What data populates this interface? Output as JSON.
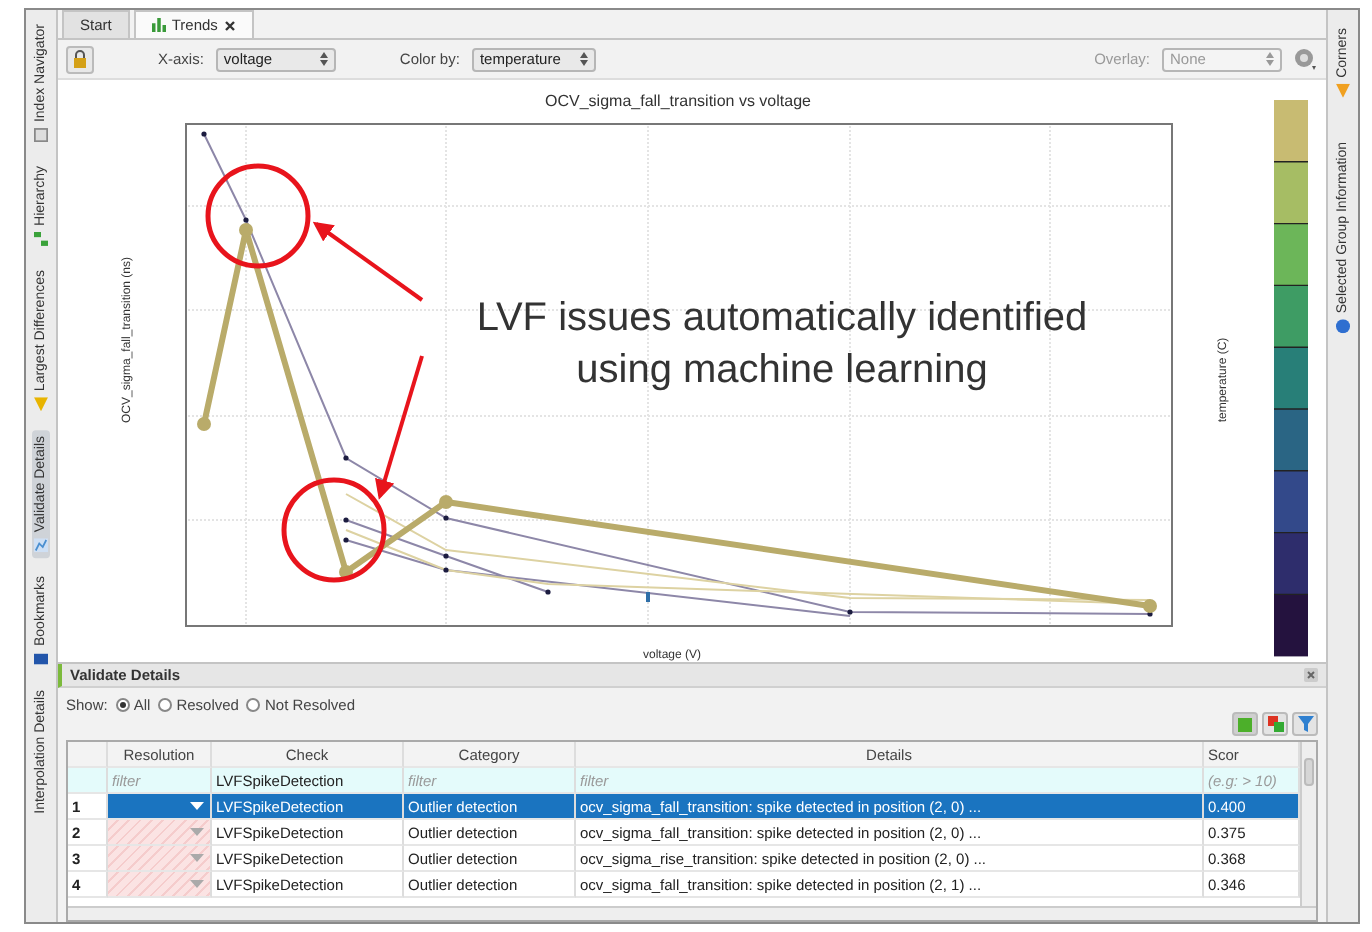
{
  "left_panel_tabs": [
    {
      "label": "Index Navigator",
      "selected": false
    },
    {
      "label": "Hierarchy",
      "selected": false
    },
    {
      "label": "Largest Differences",
      "selected": false
    },
    {
      "label": "Validate Details",
      "selected": true
    },
    {
      "label": "Bookmarks",
      "selected": false
    },
    {
      "label": "Interpolation Details",
      "selected": false
    }
  ],
  "right_panel_tabs": [
    {
      "label": "Corners"
    },
    {
      "label": "Selected Group Information"
    }
  ],
  "tabs": [
    {
      "label": "Start",
      "selected": false,
      "closable": false
    },
    {
      "label": "Trends",
      "selected": true,
      "closable": true
    }
  ],
  "toolbar": {
    "x_axis": {
      "label": "X-axis:",
      "value": "voltage"
    },
    "color_by": {
      "label": "Color by:",
      "value": "temperature"
    },
    "overlay": {
      "label": "Overlay:",
      "value": "None",
      "disabled": true
    }
  },
  "chart": {
    "title": "OCV_sigma_fall_transition vs voltage",
    "ylabel": "OCV_sigma_fall_transition (ns)",
    "xlabel": "voltage (V)",
    "colorbar_label": "temperature (C)",
    "annotation": [
      "LVF issues automatically identified",
      "using machine learning"
    ]
  },
  "details_panel": {
    "title": "Validate Details",
    "show_label": "Show:",
    "show_options": [
      {
        "label": "All",
        "selected": true
      },
      {
        "label": "Resolved",
        "selected": false
      },
      {
        "label": "Not Resolved",
        "selected": false
      }
    ],
    "columns": [
      "Resolution",
      "Check",
      "Category",
      "Details",
      "Scor"
    ],
    "filter_row": [
      "filter",
      "LVFSpikeDetection",
      "filter",
      "filter",
      "(e.g: > 10)"
    ],
    "rows": [
      {
        "number": "1",
        "check": "LVFSpikeDetection",
        "category": "Outlier detection",
        "details": "ocv_sigma_fall_transition: spike detected in position (2, 0) ...",
        "score": "0.400",
        "selected": true
      },
      {
        "number": "2",
        "check": "LVFSpikeDetection",
        "category": "Outlier detection",
        "details": "ocv_sigma_fall_transition: spike detected in position (2, 0) ...",
        "score": "0.375",
        "selected": false
      },
      {
        "number": "3",
        "check": "LVFSpikeDetection",
        "category": "Outlier detection",
        "details": "ocv_sigma_rise_transition: spike detected in position (2, 0) ...",
        "score": "0.368",
        "selected": false
      },
      {
        "number": "4",
        "check": "LVFSpikeDetection",
        "category": "Outlier detection",
        "details": "ocv_sigma_fall_transition: spike detected in position (2, 1) ...",
        "score": "0.346",
        "selected": false
      }
    ]
  }
}
